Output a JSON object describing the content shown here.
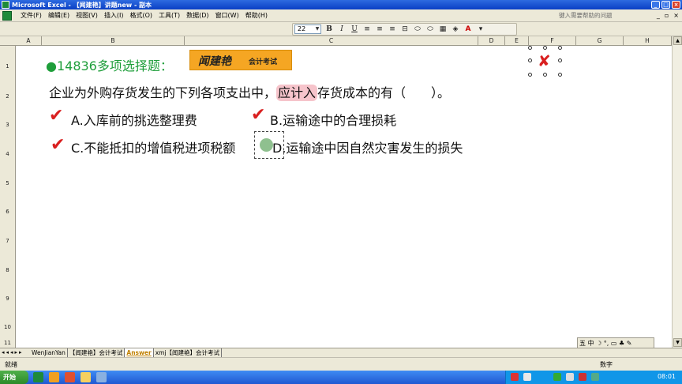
{
  "window": {
    "title": "Microsoft Excel - 【闻建艳】讲题new - 副本",
    "controls": [
      "_",
      "□",
      "×"
    ]
  },
  "menubar": {
    "items": [
      "文件(F)",
      "编辑(E)",
      "视图(V)",
      "插入(I)",
      "格式(O)",
      "工具(T)",
      "数据(D)",
      "窗口(W)",
      "帮助(H)"
    ],
    "help_placeholder": "键入需要帮助的问题",
    "mdi_controls": [
      "_",
      "▫",
      "×"
    ]
  },
  "toolbar": {
    "font_size": "22",
    "bold": "B",
    "italic": "I",
    "underline": "U",
    "font_color": "A"
  },
  "columns": [
    "A",
    "B",
    "C",
    "D",
    "E",
    "F",
    "G",
    "H"
  ],
  "rows": [
    "1",
    "2",
    "3",
    "4",
    "5",
    "6",
    "7",
    "8",
    "9",
    "10",
    "11"
  ],
  "content": {
    "question_title": "●14836多项选择题：",
    "logo_brand": "闻建艳",
    "logo_sub": "会计考试",
    "stem_before": "企业为外购存货发生的下列各项支出中，",
    "stem_highlight": "应计入",
    "stem_after": "存货成本的有（　　）。",
    "options": [
      {
        "text": "A.入库前的挑选整理费",
        "correct": true
      },
      {
        "text": "B.运输途中的合理损耗",
        "correct": true
      },
      {
        "text": "C.不能抵扣的增值税进项税额",
        "correct": true
      },
      {
        "text": "D.运输途中因自然灾害发生的损失",
        "correct": false
      }
    ],
    "check_symbol": "✔",
    "x_symbol": "✘"
  },
  "sheet_tabs": {
    "nav": "◂◂◂▸▸",
    "tabs": [
      "WenJianYan",
      "【闻建艳】会计考试",
      "Answer",
      "xmj【闻建艳】会计考试"
    ],
    "active": "Answer"
  },
  "ime_bar": "五 中 ☽ °, ▭ ♣ ✎",
  "statusbar": {
    "ready": "就绪",
    "num": "数字"
  },
  "taskbar": {
    "start": "开始",
    "clock": "08:01"
  }
}
